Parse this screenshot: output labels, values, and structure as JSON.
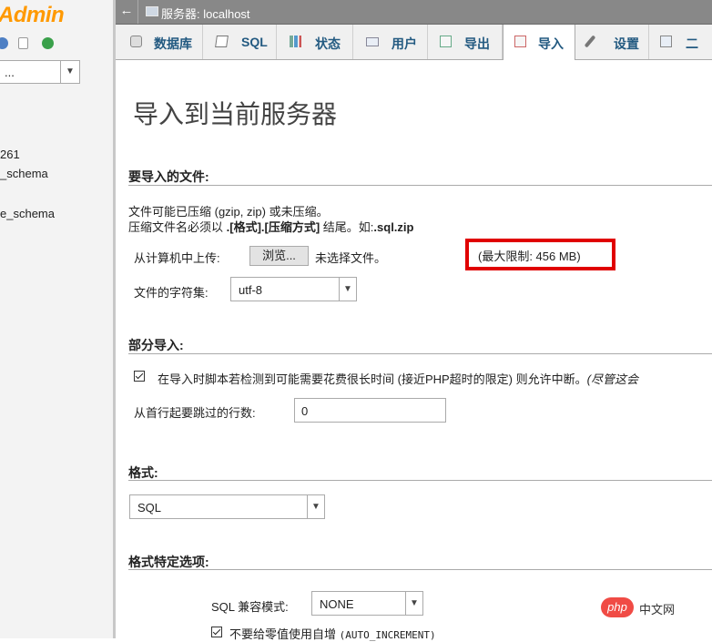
{
  "nav": {
    "logo": "Admin",
    "db_select_value": "...",
    "databases": [
      "261",
      "_schema",
      "e_schema"
    ]
  },
  "topbar": {
    "server_label": "服务器: localhost"
  },
  "tabs": [
    {
      "label": "数据库",
      "icon": "database-icon",
      "active": false
    },
    {
      "label": "SQL",
      "icon": "sql-icon",
      "active": false
    },
    {
      "label": "状态",
      "icon": "status-icon",
      "active": false
    },
    {
      "label": "用户",
      "icon": "users-icon",
      "active": false
    },
    {
      "label": "导出",
      "icon": "export-icon",
      "active": false
    },
    {
      "label": "导入",
      "icon": "import-icon",
      "active": true
    },
    {
      "label": "设置",
      "icon": "wrench-icon",
      "active": false
    },
    {
      "label": "二",
      "icon": "binlog-icon",
      "active": false
    }
  ],
  "main": {
    "title": "导入到当前服务器",
    "file_section": {
      "heading": "要导入的文件:",
      "note1": "文件可能已压缩 (gzip, zip) 或未压缩。",
      "note2_prefix": "压缩文件名必须以 ",
      "note2_bold": ".[格式].[压缩方式]",
      "note2_mid": " 结尾。如:",
      "note2_example": ".sql.zip",
      "upload_label": "从计算机中上传:",
      "browse_button": "浏览...",
      "no_file": "未选择文件。",
      "max_limit": "(最大限制: 456 MB)",
      "charset_label": "文件的字符集:",
      "charset_value": "utf-8"
    },
    "partial_section": {
      "heading": "部分导入:",
      "allow_interrupt_label": "在导入时脚本若检测到可能需要花费很长时间 (接近PHP超时的限定) 则允许中断。",
      "allow_interrupt_note": "(尽管这会",
      "allow_interrupt_checked": true,
      "skip_label": "从首行起要跳过的行数:",
      "skip_value": "0"
    },
    "format_section": {
      "heading": "格式:",
      "format_value": "SQL"
    },
    "format_options_section": {
      "heading": "格式特定选项:",
      "compat_label": "SQL 兼容模式:",
      "compat_value": "NONE",
      "no_auto_value_label": "不要给零值使用自增",
      "no_auto_value_code": "(AUTO_INCREMENT)",
      "no_auto_value_checked": true
    }
  },
  "watermark": {
    "badge": "php",
    "text": "中文网"
  },
  "colors": {
    "logo": "#ff9900",
    "tab_text": "#235a81",
    "highlight_box": "#e00000",
    "topbar": "#888888"
  }
}
